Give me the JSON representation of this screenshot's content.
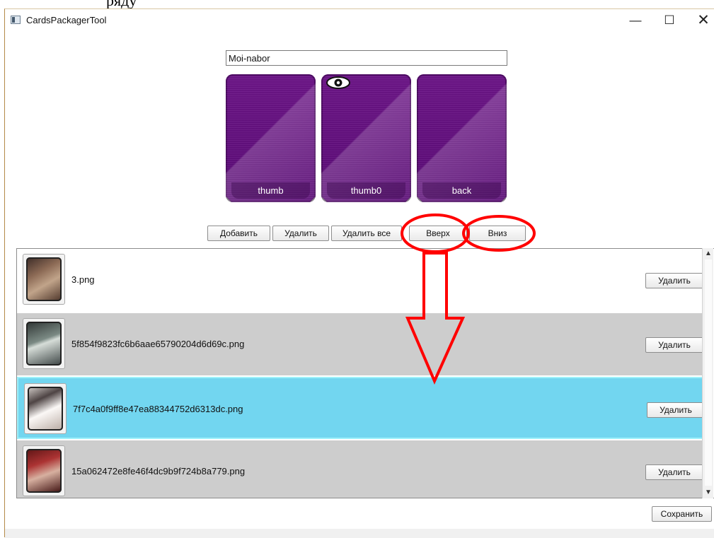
{
  "background_text": "ряду",
  "window": {
    "title": "CardsPackagerTool",
    "controls": {
      "minimize": "—",
      "maximize": "☐",
      "close": "✕"
    }
  },
  "set_name": "Moi-nabor",
  "cards": [
    {
      "label": "thumb"
    },
    {
      "label": "thumb0"
    },
    {
      "label": "back"
    }
  ],
  "toolbar": {
    "add": "Добавить",
    "delete": "Удалить",
    "delete_all": "Удалить все",
    "up": "Вверх",
    "down": "Вниз"
  },
  "list": {
    "items": [
      {
        "filename": "3.png",
        "delete_label": "Удалить"
      },
      {
        "filename": "5f854f9823fc6b6aae65790204d6d69c.png",
        "delete_label": "Удалить"
      },
      {
        "filename": "7f7c4a0f9ff8e47ea88344752d6313dc.png",
        "delete_label": "Удалить"
      },
      {
        "filename": "15a062472e8fe46f4dc9b9f724b8a779.png",
        "delete_label": "Удалить"
      }
    ]
  },
  "save_label": "Сохранить",
  "colors": {
    "selected_row": "#72d6f0",
    "annotation": "#ff0000"
  },
  "icons": {
    "card_preview": "eye-icon",
    "down_annotation": "down-arrow-icon"
  }
}
